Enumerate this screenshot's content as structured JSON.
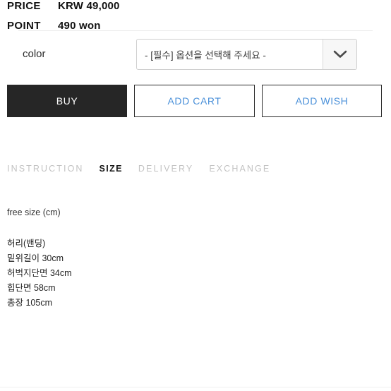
{
  "product_info": {
    "price_label": "PRICE",
    "price_value": "KRW 49,000",
    "point_label": "POINT",
    "point_value": "490 won"
  },
  "option": {
    "label": "color",
    "selected_text": "- [필수] 옵션을 선택해 주세요 -",
    "arrow_icon": "chevron-down-icon"
  },
  "actions": {
    "buy": "BUY",
    "add_cart": "ADD CART",
    "add_wish": "ADD WISH",
    "buy_bg": "#262626",
    "link_color": "#4a90d9"
  },
  "tabs": [
    {
      "label": "INSTRUCTION",
      "active": false
    },
    {
      "label": "SIZE",
      "active": true
    },
    {
      "label": "DELIVERY",
      "active": false
    },
    {
      "label": "EXCHANGE",
      "active": false
    }
  ],
  "size_content": {
    "heading": "free size (cm)",
    "measurements": [
      "허리(밴딩)",
      "밑위길이 30cm",
      "허벅지단면 34cm",
      "힙단면 58cm",
      "총장 105cm"
    ]
  }
}
